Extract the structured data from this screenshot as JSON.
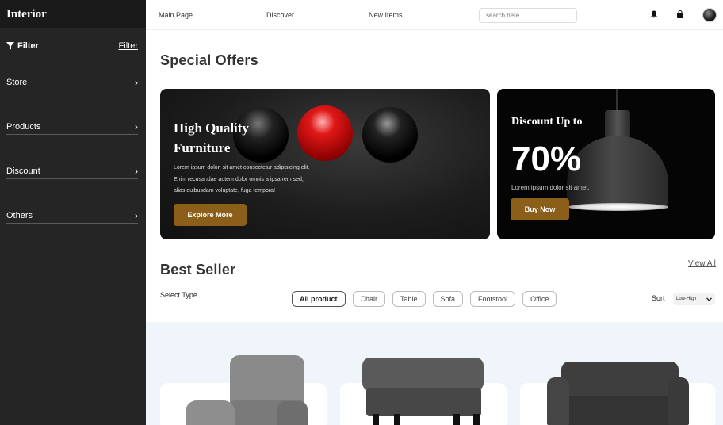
{
  "sidebar": {
    "brand": "Interior",
    "filter_title": "Filter",
    "filter_link": "Filter",
    "items": [
      {
        "label": "Store"
      },
      {
        "label": "Products"
      },
      {
        "label": "Discount"
      },
      {
        "label": "Others"
      }
    ]
  },
  "header": {
    "nav": [
      "Main Page",
      "Discover",
      "New Items"
    ],
    "search_placeholder": "search here",
    "icons": [
      "bell-icon",
      "bag-icon",
      "avatar"
    ]
  },
  "offers": {
    "title": "Special Offers",
    "main": {
      "title_line1": "High Quality",
      "title_line2": "Furniture",
      "desc_line1": "Lorem ipsum dolor, sit amet consectetur adipisicing elit.",
      "desc_line2": "Enim recusandae autem dolor omnis a ipsa rem sed,",
      "desc_line3": "alias quibusdam voluptate, fuga tempora!",
      "button": "Explore More"
    },
    "side": {
      "title": "Discount Up to",
      "percent": "70%",
      "desc": "Lorem ipsum dolor sit amet.",
      "button": "Buy Now"
    }
  },
  "bestseller": {
    "title": "Best Seller",
    "view_all": "View All",
    "select_type": "Select Type",
    "chips": [
      "All product",
      "Chair",
      "Table",
      "Sofa",
      "Footstool",
      "Office"
    ],
    "active_chip": "All product",
    "sort_label": "Sort",
    "sort_value": "Low-High"
  },
  "colors": {
    "sidebar_bg": "#252525",
    "accent_gold": "#8b5f19",
    "product_bg": "#f0f5fc"
  }
}
